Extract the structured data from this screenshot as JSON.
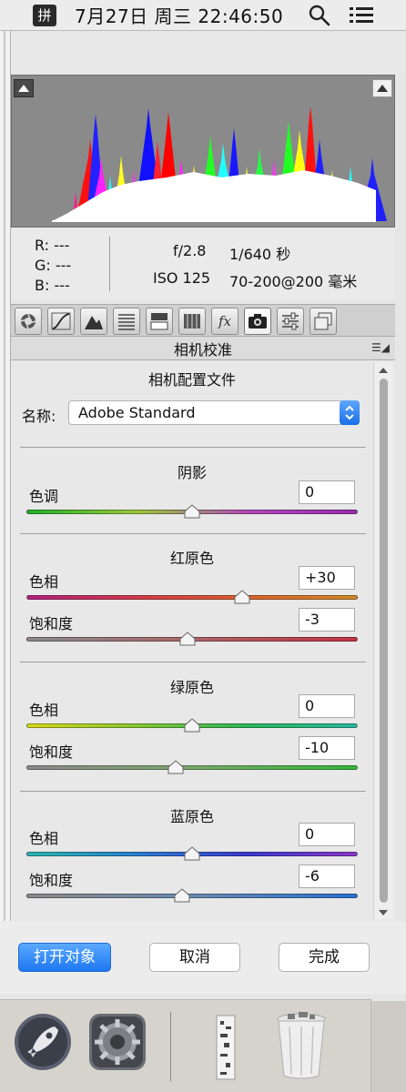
{
  "menubar": {
    "ime": "拼",
    "clock": "7月27日 周三  22:46:50"
  },
  "info": {
    "r": "R:  ---",
    "g": "G:  ---",
    "b": "B:  ---",
    "aperture": "f/2.8",
    "shutter": "1/640 秒",
    "iso": "ISO 125",
    "lens": "70-200@200 毫米"
  },
  "tabs": [
    {
      "icon": "basic-icon"
    },
    {
      "icon": "tone-curve-icon"
    },
    {
      "icon": "detail-icon"
    },
    {
      "icon": "hsl-icon"
    },
    {
      "icon": "split-toning-icon"
    },
    {
      "icon": "lens-corrections-icon"
    },
    {
      "icon": "effects-fx-icon",
      "glyph": "fx"
    },
    {
      "icon": "camera-calibration-icon",
      "active": true
    },
    {
      "icon": "presets-icon"
    },
    {
      "icon": "snapshots-icon"
    }
  ],
  "panel": {
    "title": "相机校准",
    "profile_heading": "相机配置文件",
    "name_label": "名称:",
    "profile_value": "Adobe Standard",
    "shadows": {
      "heading": "阴影",
      "tint_label": "色调",
      "tint_value": "0",
      "tint_level": 0.5
    },
    "red": {
      "heading": "红原色",
      "hue_label": "色相",
      "hue_value": "+30",
      "hue_level": 0.65,
      "sat_label": "饱和度",
      "sat_value": "-3",
      "sat_level": 0.485
    },
    "green": {
      "heading": "绿原色",
      "hue_label": "色相",
      "hue_value": "0",
      "hue_level": 0.5,
      "sat_label": "饱和度",
      "sat_value": "-10",
      "sat_level": 0.45
    },
    "blue": {
      "heading": "蓝原色",
      "hue_label": "色相",
      "hue_value": "0",
      "hue_level": 0.5,
      "sat_label": "饱和度",
      "sat_value": "-6",
      "sat_level": 0.47
    }
  },
  "buttons": {
    "open": "打开对象",
    "cancel": "取消",
    "done": "完成"
  },
  "colors": {
    "accent": "#1e78f0",
    "histogram_bg": "#8a8a8a"
  }
}
